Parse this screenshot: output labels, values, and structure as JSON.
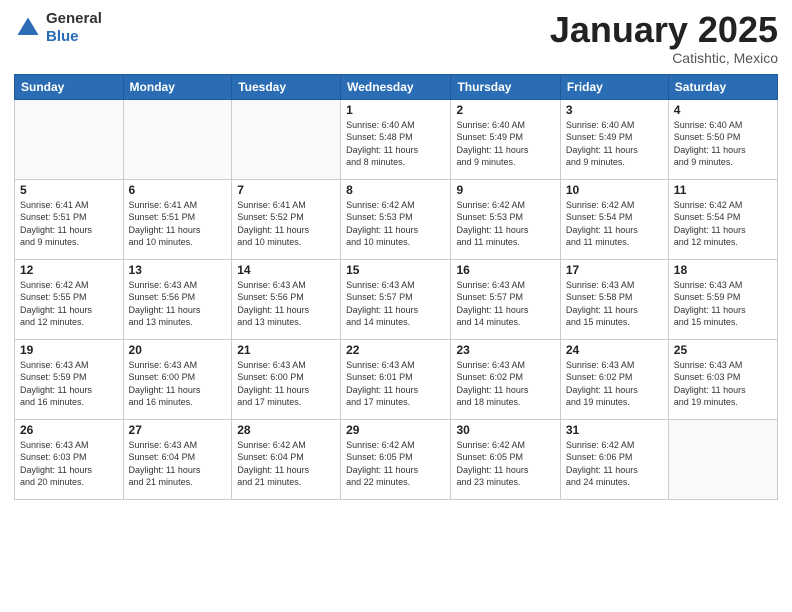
{
  "logo": {
    "general": "General",
    "blue": "Blue"
  },
  "header": {
    "month": "January 2025",
    "location": "Catishtic, Mexico"
  },
  "weekdays": [
    "Sunday",
    "Monday",
    "Tuesday",
    "Wednesday",
    "Thursday",
    "Friday",
    "Saturday"
  ],
  "weeks": [
    [
      {
        "day": "",
        "info": ""
      },
      {
        "day": "",
        "info": ""
      },
      {
        "day": "",
        "info": ""
      },
      {
        "day": "1",
        "info": "Sunrise: 6:40 AM\nSunset: 5:48 PM\nDaylight: 11 hours\nand 8 minutes."
      },
      {
        "day": "2",
        "info": "Sunrise: 6:40 AM\nSunset: 5:49 PM\nDaylight: 11 hours\nand 9 minutes."
      },
      {
        "day": "3",
        "info": "Sunrise: 6:40 AM\nSunset: 5:49 PM\nDaylight: 11 hours\nand 9 minutes."
      },
      {
        "day": "4",
        "info": "Sunrise: 6:40 AM\nSunset: 5:50 PM\nDaylight: 11 hours\nand 9 minutes."
      }
    ],
    [
      {
        "day": "5",
        "info": "Sunrise: 6:41 AM\nSunset: 5:51 PM\nDaylight: 11 hours\nand 9 minutes."
      },
      {
        "day": "6",
        "info": "Sunrise: 6:41 AM\nSunset: 5:51 PM\nDaylight: 11 hours\nand 10 minutes."
      },
      {
        "day": "7",
        "info": "Sunrise: 6:41 AM\nSunset: 5:52 PM\nDaylight: 11 hours\nand 10 minutes."
      },
      {
        "day": "8",
        "info": "Sunrise: 6:42 AM\nSunset: 5:53 PM\nDaylight: 11 hours\nand 10 minutes."
      },
      {
        "day": "9",
        "info": "Sunrise: 6:42 AM\nSunset: 5:53 PM\nDaylight: 11 hours\nand 11 minutes."
      },
      {
        "day": "10",
        "info": "Sunrise: 6:42 AM\nSunset: 5:54 PM\nDaylight: 11 hours\nand 11 minutes."
      },
      {
        "day": "11",
        "info": "Sunrise: 6:42 AM\nSunset: 5:54 PM\nDaylight: 11 hours\nand 12 minutes."
      }
    ],
    [
      {
        "day": "12",
        "info": "Sunrise: 6:42 AM\nSunset: 5:55 PM\nDaylight: 11 hours\nand 12 minutes."
      },
      {
        "day": "13",
        "info": "Sunrise: 6:43 AM\nSunset: 5:56 PM\nDaylight: 11 hours\nand 13 minutes."
      },
      {
        "day": "14",
        "info": "Sunrise: 6:43 AM\nSunset: 5:56 PM\nDaylight: 11 hours\nand 13 minutes."
      },
      {
        "day": "15",
        "info": "Sunrise: 6:43 AM\nSunset: 5:57 PM\nDaylight: 11 hours\nand 14 minutes."
      },
      {
        "day": "16",
        "info": "Sunrise: 6:43 AM\nSunset: 5:57 PM\nDaylight: 11 hours\nand 14 minutes."
      },
      {
        "day": "17",
        "info": "Sunrise: 6:43 AM\nSunset: 5:58 PM\nDaylight: 11 hours\nand 15 minutes."
      },
      {
        "day": "18",
        "info": "Sunrise: 6:43 AM\nSunset: 5:59 PM\nDaylight: 11 hours\nand 15 minutes."
      }
    ],
    [
      {
        "day": "19",
        "info": "Sunrise: 6:43 AM\nSunset: 5:59 PM\nDaylight: 11 hours\nand 16 minutes."
      },
      {
        "day": "20",
        "info": "Sunrise: 6:43 AM\nSunset: 6:00 PM\nDaylight: 11 hours\nand 16 minutes."
      },
      {
        "day": "21",
        "info": "Sunrise: 6:43 AM\nSunset: 6:00 PM\nDaylight: 11 hours\nand 17 minutes."
      },
      {
        "day": "22",
        "info": "Sunrise: 6:43 AM\nSunset: 6:01 PM\nDaylight: 11 hours\nand 17 minutes."
      },
      {
        "day": "23",
        "info": "Sunrise: 6:43 AM\nSunset: 6:02 PM\nDaylight: 11 hours\nand 18 minutes."
      },
      {
        "day": "24",
        "info": "Sunrise: 6:43 AM\nSunset: 6:02 PM\nDaylight: 11 hours\nand 19 minutes."
      },
      {
        "day": "25",
        "info": "Sunrise: 6:43 AM\nSunset: 6:03 PM\nDaylight: 11 hours\nand 19 minutes."
      }
    ],
    [
      {
        "day": "26",
        "info": "Sunrise: 6:43 AM\nSunset: 6:03 PM\nDaylight: 11 hours\nand 20 minutes."
      },
      {
        "day": "27",
        "info": "Sunrise: 6:43 AM\nSunset: 6:04 PM\nDaylight: 11 hours\nand 21 minutes."
      },
      {
        "day": "28",
        "info": "Sunrise: 6:42 AM\nSunset: 6:04 PM\nDaylight: 11 hours\nand 21 minutes."
      },
      {
        "day": "29",
        "info": "Sunrise: 6:42 AM\nSunset: 6:05 PM\nDaylight: 11 hours\nand 22 minutes."
      },
      {
        "day": "30",
        "info": "Sunrise: 6:42 AM\nSunset: 6:05 PM\nDaylight: 11 hours\nand 23 minutes."
      },
      {
        "day": "31",
        "info": "Sunrise: 6:42 AM\nSunset: 6:06 PM\nDaylight: 11 hours\nand 24 minutes."
      },
      {
        "day": "",
        "info": ""
      }
    ]
  ]
}
